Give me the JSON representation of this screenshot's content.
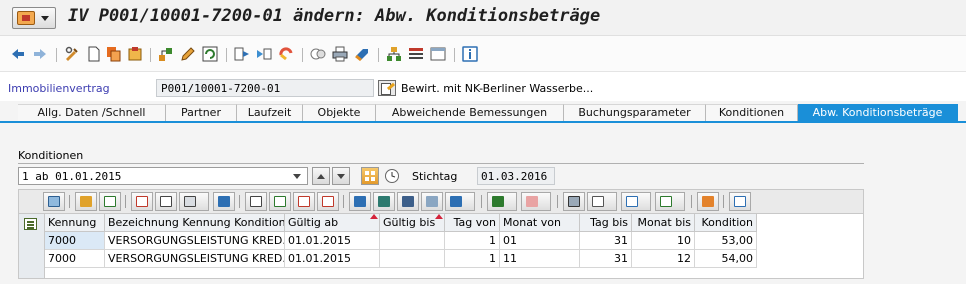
{
  "window": {
    "title": "IV P001/10001-7200-01 ändern: Abw. Konditionsbeträge"
  },
  "toolbar": {
    "icons": [
      "back-icon",
      "forward-icon",
      "display-change-icon",
      "create-icon",
      "copy-icon",
      "save-variant-icon",
      "hierarchy-icon",
      "edit-icon",
      "refresh-icon",
      "execute-icon",
      "expand-icon",
      "cycle-icon",
      "object-icon",
      "print-icon",
      "flag-icon",
      "org-icon",
      "list-icon",
      "window-icon",
      "info-icon"
    ]
  },
  "header": {
    "label": "Immobilienvertrag",
    "contract_number": "P001/10001-7200-01",
    "description": "Bewirt. mit NK-Berliner Wasserbe..."
  },
  "tabs": [
    {
      "label": "Allg. Daten /Schnell",
      "active": false
    },
    {
      "label": "Partner",
      "active": false
    },
    {
      "label": "Laufzeit",
      "active": false
    },
    {
      "label": "Objekte",
      "active": false
    },
    {
      "label": "Abweichende Bemessungen",
      "active": false
    },
    {
      "label": "Buchungsparameter",
      "active": false
    },
    {
      "label": "Konditionen",
      "active": false
    },
    {
      "label": "Abw. Konditionsbeträge",
      "active": true
    }
  ],
  "konditionen": {
    "section_title": "Konditionen",
    "selected_entry": "1 ab 01.01.2015",
    "stichtag_label": "Stichtag",
    "stichtag_value": "01.03.2016",
    "colors": {
      "accent": "#1a8fd8",
      "sort_marker": "#d4243b"
    }
  },
  "alv_toolbar": {
    "icons": [
      "details-icon",
      "hierarchy-icon",
      "refresh-icon",
      "cut-icon",
      "copy-icon",
      "paste-icon",
      "undo-icon",
      "append-row-icon",
      "insert-row-icon",
      "delete-row-icon",
      "copy-row-icon",
      "sort-ascending-icon",
      "sort-descending-icon",
      "find-icon",
      "find-next-icon",
      "filter-icon",
      "sum-icon",
      "subtotal-icon",
      "print-icon",
      "views-icon",
      "export-icon",
      "layout-icon",
      "graphic-icon",
      "info-icon"
    ]
  },
  "table": {
    "columns": [
      "Kennung",
      "Bezeichnung Kennung Kondition",
      "Gültig ab",
      "Gültig bis",
      "Tag von",
      "Monat von",
      "Tag bis",
      "Monat bis",
      "Kondition"
    ],
    "rows": [
      [
        "7000",
        "VERSORGUNGSLEISTUNG KRED.",
        "01.01.2015",
        "",
        "1",
        "01",
        "31",
        "10",
        "53,00"
      ],
      [
        "7000",
        "VERSORGUNGSLEISTUNG KRED.",
        "01.01.2015",
        "",
        "1",
        "11",
        "31",
        "12",
        "54,00"
      ]
    ]
  }
}
